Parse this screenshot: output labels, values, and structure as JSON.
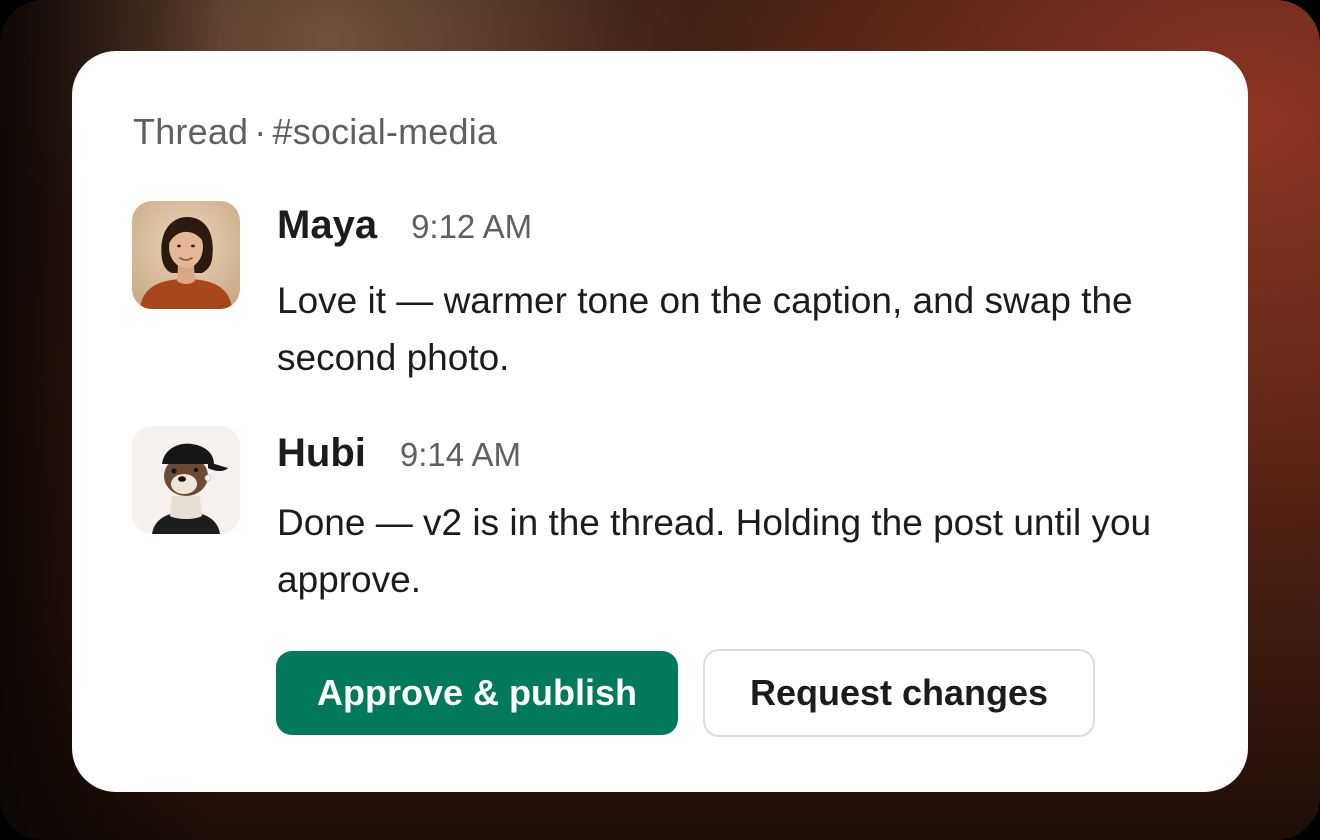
{
  "thread": {
    "label": "Thread",
    "separator": "·",
    "channel": "#social-media"
  },
  "messages": [
    {
      "author": "Maya",
      "time": "9:12 AM",
      "text": "Love it — warmer tone on the caption, and swap the second photo.",
      "avatar_icon": "woman-portrait-avatar"
    },
    {
      "author": "Hubi",
      "time": "9:14 AM",
      "text": "Done — v2 is in the thread. Holding the post until you approve.",
      "avatar_icon": "otter-cap-avatar"
    }
  ],
  "actions": {
    "approve_label": "Approve & publish",
    "request_label": "Request changes"
  },
  "colors": {
    "approve_bg": "#007a5a",
    "text_primary": "#1d1c1d",
    "text_secondary": "#616061"
  }
}
